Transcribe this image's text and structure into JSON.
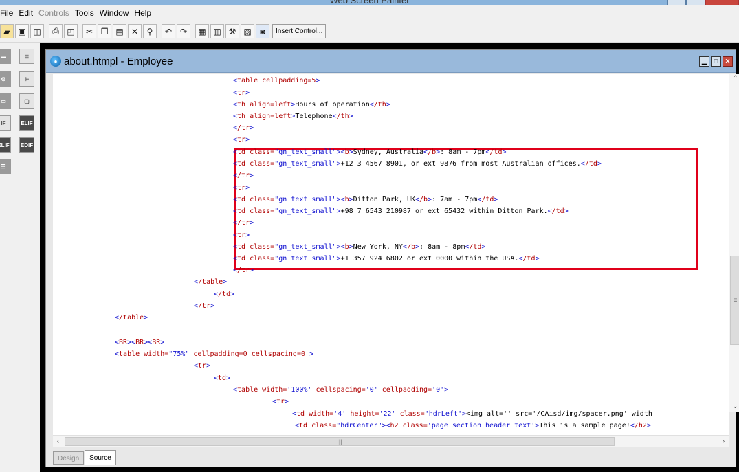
{
  "app": {
    "title": "Web Screen Painter"
  },
  "menu": [
    {
      "label": "File",
      "enabled": true
    },
    {
      "label": "Edit",
      "enabled": true
    },
    {
      "label": "Controls",
      "enabled": false
    },
    {
      "label": "Tools",
      "enabled": true
    },
    {
      "label": "Window",
      "enabled": true
    },
    {
      "label": "Help",
      "enabled": true
    }
  ],
  "toolbar": {
    "insert_control_label": "Insert Control..."
  },
  "toolbox": {
    "elif_label": "ELIF",
    "elif2_label": "ELIF",
    "endif_label": "EDIF"
  },
  "document": {
    "title": "about.htmpl - Employee",
    "active_tab": "Source",
    "tabs": [
      "Design",
      "Source"
    ]
  },
  "source_lines": [
    "<table cellpadding=5>",
    "<tr>",
    "<th align=left>Hours of operation</th>",
    "<th align=left>Telephone</th>",
    "</tr>",
    "<tr>",
    "<td class=\"gn_text_small\"><b>Sydney, Australia</b>: 8am - 7pm</td>",
    "<td class=\"gn_text_small\">+12 3 4567 8901, or ext 9876 from most Australian offices.</td>",
    "</tr>",
    "<tr>",
    "<td class=\"gn_text_small\"><b>Ditton Park, UK</b>: 7am - 7pm</td>",
    "<td class=\"gn_text_small\">+98 7 6543 210987 or ext 65432 within Ditton Park.</td>",
    "</tr>",
    "<tr>",
    "<td class=\"gn_text_small\"><b>New York, NY</b>: 8am - 8pm</td>",
    "<td class=\"gn_text_small\">+1 357 924 6802 or ext 0000 within the USA.</td>",
    "</tr>",
    "</table>",
    "</td>",
    "</tr>",
    "</table>",
    "",
    "<BR><BR><BR>",
    "<table width=\"75%\" cellpadding=0 cellspacing=0 >",
    "<tr>",
    "<td>",
    "<table width='100%' cellspacing='0' cellpadding='0'>",
    "<tr>",
    "<td width='4' height='22' class=\"hdrLeft\"><img alt='' src='/CAisd/img/spacer.png' width",
    "<td class=\"hdrCenter\"><h2 class='page_section_header_text'>This is a sample page!</h2>"
  ]
}
